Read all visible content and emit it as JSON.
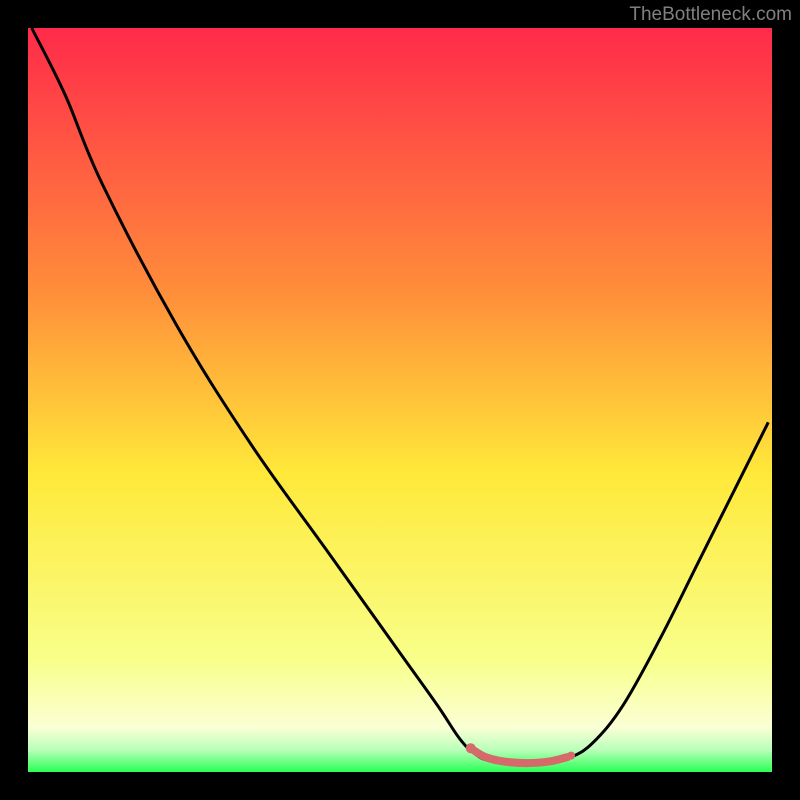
{
  "watermark": "TheBottleneck.com",
  "chart_data": {
    "type": "line",
    "title": "",
    "xlabel": "",
    "ylabel": "",
    "xlim": [
      0,
      100
    ],
    "ylim": [
      0,
      100
    ],
    "gradient_stops": [
      {
        "offset": 0,
        "color": "#ff2a4a"
      },
      {
        "offset": 35,
        "color": "#ff8c3a"
      },
      {
        "offset": 60,
        "color": "#ffe93a"
      },
      {
        "offset": 85,
        "color": "#f8ff8a"
      },
      {
        "offset": 94,
        "color": "#faffd5"
      },
      {
        "offset": 97,
        "color": "#baffba"
      },
      {
        "offset": 100,
        "color": "#2aff55"
      }
    ],
    "series": [
      {
        "name": "bottleneck-curve",
        "color": "#000000",
        "points": [
          {
            "x": 0.5,
            "y": 100
          },
          {
            "x": 5,
            "y": 91
          },
          {
            "x": 10,
            "y": 79
          },
          {
            "x": 20,
            "y": 60
          },
          {
            "x": 30,
            "y": 44
          },
          {
            "x": 40,
            "y": 30
          },
          {
            "x": 50,
            "y": 16
          },
          {
            "x": 55,
            "y": 9
          },
          {
            "x": 58,
            "y": 4.5
          },
          {
            "x": 60,
            "y": 2.5
          },
          {
            "x": 62,
            "y": 1.5
          },
          {
            "x": 66,
            "y": 1
          },
          {
            "x": 70,
            "y": 1.2
          },
          {
            "x": 73,
            "y": 2
          },
          {
            "x": 76,
            "y": 4
          },
          {
            "x": 80,
            "y": 9
          },
          {
            "x": 85,
            "y": 18
          },
          {
            "x": 90,
            "y": 28
          },
          {
            "x": 95,
            "y": 38
          },
          {
            "x": 99.5,
            "y": 47
          }
        ]
      },
      {
        "name": "optimal-zone",
        "color": "#d66a6a",
        "points": [
          {
            "x": 59.5,
            "y": 3.2
          },
          {
            "x": 61.5,
            "y": 2.0
          },
          {
            "x": 64,
            "y": 1.4
          },
          {
            "x": 67,
            "y": 1.2
          },
          {
            "x": 70,
            "y": 1.4
          },
          {
            "x": 72.5,
            "y": 2.0
          }
        ]
      }
    ],
    "markers": [
      {
        "x": 59.5,
        "y": 3.2,
        "r": 5,
        "color": "#d66a6a"
      },
      {
        "x": 73,
        "y": 2.2,
        "r": 4,
        "color": "#d66a6a"
      }
    ]
  }
}
